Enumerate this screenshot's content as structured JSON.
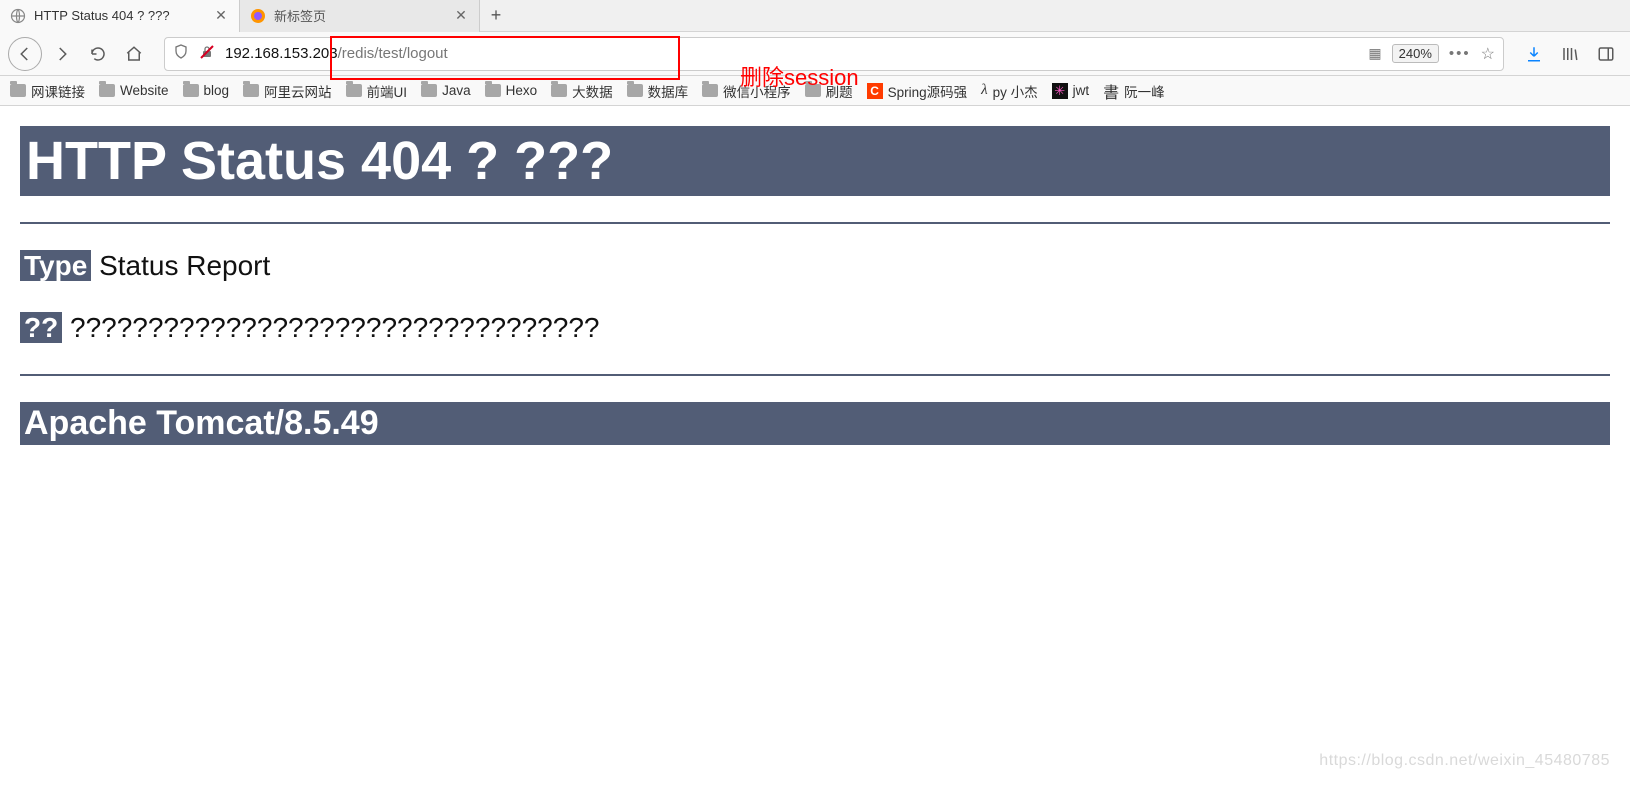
{
  "tabs": [
    {
      "title": "HTTP Status 404 ? ???",
      "active": true
    },
    {
      "title": "新标签页",
      "active": false
    }
  ],
  "url": {
    "host": "192.168.153.203",
    "path": "/redis/test/logout"
  },
  "zoom": "240%",
  "bookmarks": [
    {
      "kind": "folder",
      "label": "网课链接"
    },
    {
      "kind": "folder",
      "label": "Website"
    },
    {
      "kind": "folder",
      "label": "blog"
    },
    {
      "kind": "folder",
      "label": "阿里云网站"
    },
    {
      "kind": "folder",
      "label": "前端UI"
    },
    {
      "kind": "folder",
      "label": "Java"
    },
    {
      "kind": "folder",
      "label": "Hexo"
    },
    {
      "kind": "folder",
      "label": "大数据"
    },
    {
      "kind": "folder",
      "label": "数据库"
    },
    {
      "kind": "folder",
      "label": "微信小程序"
    },
    {
      "kind": "folder",
      "label": "刷题"
    },
    {
      "kind": "c",
      "label": "Spring源码强"
    },
    {
      "kind": "lambda",
      "label": "py 小杰"
    },
    {
      "kind": "star",
      "label": "jwt"
    },
    {
      "kind": "brush",
      "label": "阮一峰"
    }
  ],
  "annotation": "删除session",
  "error": {
    "heading": "HTTP Status 404 ? ???",
    "type_label": "Type",
    "type_value": "Status Report",
    "msg_label": "??",
    "msg_value": "??????????????????????????????????",
    "server": "Apache Tomcat/8.5.49"
  },
  "watermark": "https://blog.csdn.net/weixin_45480785"
}
